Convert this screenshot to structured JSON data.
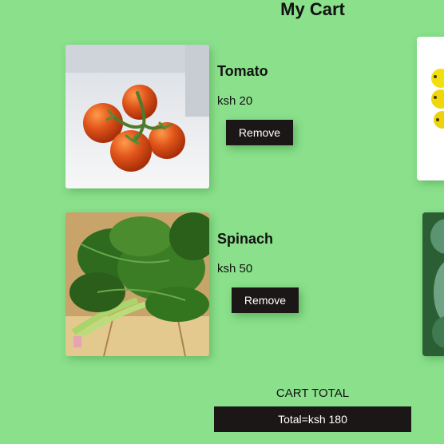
{
  "page": {
    "title": "My Cart"
  },
  "items": [
    {
      "name": "Tomato",
      "price": "ksh 20",
      "remove_label": "Remove",
      "image": "tomato-vine-photo"
    },
    {
      "name": "Spinach",
      "price": "ksh 50",
      "remove_label": "Remove",
      "image": "spinach-bunch-photo"
    }
  ],
  "summary": {
    "heading": "CART TOTAL",
    "total": "Total=ksh 180"
  },
  "colors": {
    "background": "#8ae08b",
    "button": "#1b1717",
    "button_text": "#ffffff"
  }
}
